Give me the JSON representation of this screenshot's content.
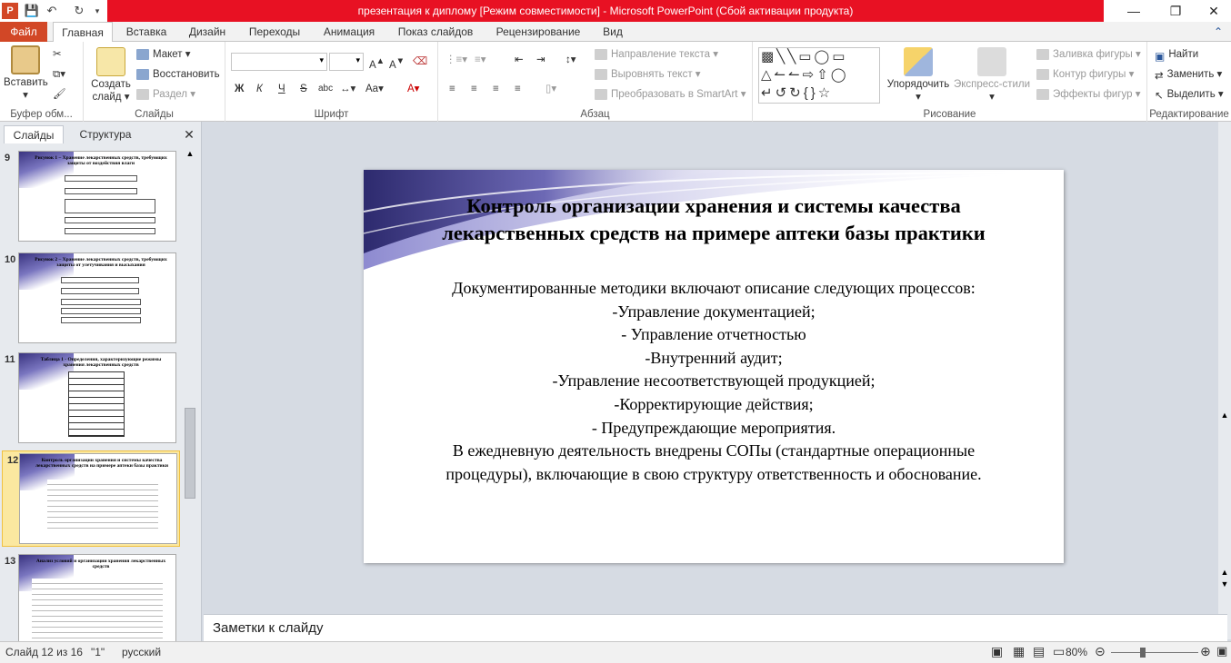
{
  "window": {
    "title": "презентация к диплому [Режим совместимости] - Microsoft PowerPoint (Сбой активации продукта)"
  },
  "tabs": [
    "Файл",
    "Главная",
    "Вставка",
    "Дизайн",
    "Переходы",
    "Анимация",
    "Показ слайдов",
    "Рецензирование",
    "Вид"
  ],
  "ribbon": {
    "clipboard": {
      "paste": "Вставить",
      "label": "Буфер обм..."
    },
    "slides": {
      "new_slide_1": "Создать",
      "new_slide_2": "слайд",
      "layout": "Макет",
      "reset": "Восстановить",
      "section": "Раздел",
      "label": "Слайды"
    },
    "font": {
      "label": "Шрифт",
      "bold": "Ж",
      "italic": "К",
      "underline": "Ч",
      "strike": "S",
      "shadow": "abc"
    },
    "paragraph": {
      "text_direction": "Направление текста",
      "align_text": "Выровнять текст",
      "smartart": "Преобразовать в SmartArt",
      "label": "Абзац"
    },
    "drawing": {
      "arrange": "Упорядочить",
      "quick_styles": "Экспресс-стили",
      "fill": "Заливка фигуры",
      "outline": "Контур фигуры",
      "effects": "Эффекты фигур",
      "label": "Рисование"
    },
    "editing": {
      "find": "Найти",
      "replace": "Заменить",
      "select": "Выделить",
      "label": "Редактирование"
    }
  },
  "pane": {
    "tab_slides": "Слайды",
    "tab_outline": "Структура"
  },
  "thumbnails": [
    {
      "num": "9",
      "title": "Рисунок 1 – Хранение лекарственных средств, требующих защиты от воздействия влаги"
    },
    {
      "num": "10",
      "title": "Рисунок 2 – Хранение лекарственных средств, требующих защиты от улетучивания и высыхания"
    },
    {
      "num": "11",
      "title": "Таблица 1 - Определения, характеризующие режимы хранения лекарственных средств"
    },
    {
      "num": "12",
      "title": "Контроль организации хранения и системы качества лекарственных средств на примере аптеки базы практики"
    },
    {
      "num": "13",
      "title": "Анализ условий и организации хранения лекарственных средств"
    }
  ],
  "slide": {
    "title": "Контроль организации хранения и системы качества лекарственных средств на примере аптеки базы практики",
    "lines": [
      "Документированные  методики включают описание следующих процессов:",
      "-Управление  документацией;",
      "- Управление  отчетностью",
      "-Внутренний  аудит;",
      "-Управление  несоответствующей  продукцией;",
      "-Корректирующие  действия;",
      "- Предупреждающие  мероприятия.",
      "В ежедневную  деятельность  внедрены  СОПы (стандартные операционные  процедуры),  включающие в свою структуру ответственность  и обоснование."
    ]
  },
  "notes": {
    "placeholder": "Заметки к слайду"
  },
  "status": {
    "slide_info": "Слайд 12 из 16",
    "theme": "\"1\"",
    "language": "русский",
    "zoom": "80%"
  }
}
